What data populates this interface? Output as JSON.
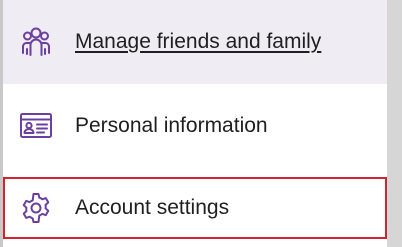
{
  "menu": {
    "items": [
      {
        "id": "friends",
        "label": "Manage friends and family",
        "icon": "people-group-icon",
        "state": "hovered"
      },
      {
        "id": "personal",
        "label": "Personal information",
        "icon": "id-card-icon",
        "state": "default"
      },
      {
        "id": "settings",
        "label": "Account settings",
        "icon": "gear-icon",
        "state": "focused"
      }
    ]
  },
  "colors": {
    "icon_purple": "#6b3fa0",
    "hover_background": "#f0ecf4",
    "focus_outline": "#d0252f",
    "text": "#1f1f1f"
  }
}
